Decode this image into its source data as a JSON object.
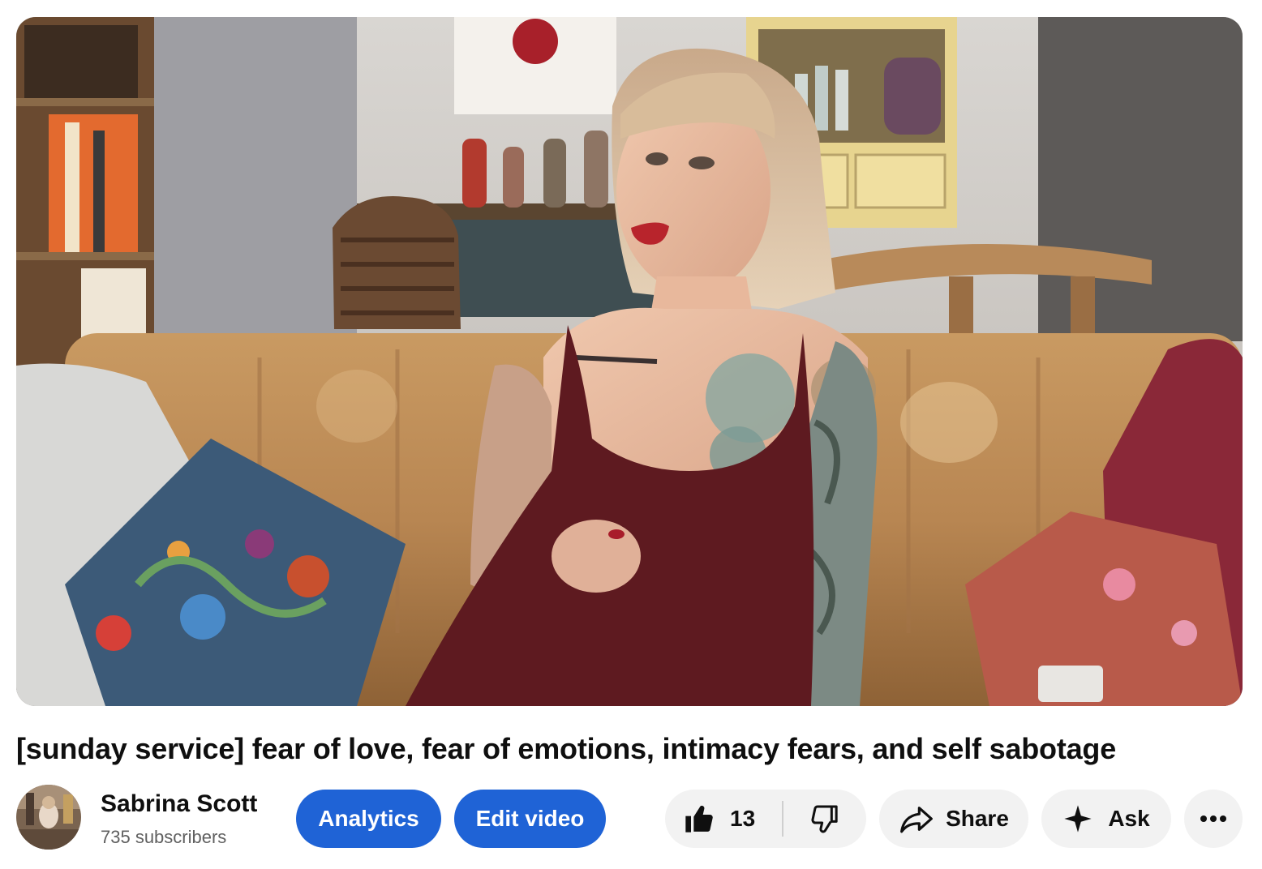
{
  "video": {
    "title": "[sunday service] fear of love, fear of emotions, intimacy fears, and self sabotage"
  },
  "channel": {
    "name": "Sabrina Scott",
    "subscribers": "735 subscribers"
  },
  "actions": {
    "analytics_label": "Analytics",
    "edit_label": "Edit video",
    "like_count": "13",
    "share_label": "Share",
    "ask_label": "Ask"
  },
  "icons": {
    "like": "thumbs-up-icon",
    "dislike": "thumbs-down-icon",
    "share": "share-arrow-icon",
    "ask": "sparkle-icon",
    "more": "more-horizontal-icon"
  },
  "colors": {
    "primary_button": "#1f63d6",
    "secondary_button": "#f2f2f2",
    "text": "#0f0f0f",
    "muted_text": "#606060"
  }
}
